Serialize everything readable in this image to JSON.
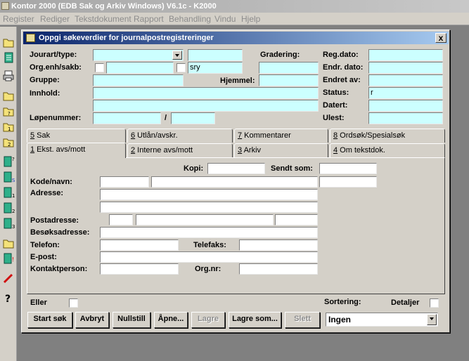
{
  "app": {
    "title": "Kontor 2000 (EDB Sak og Arkiv Windows) V6.1c - K2000"
  },
  "menu": [
    "Register",
    "Rediger",
    "Tekstdokument",
    "Rapport",
    "Behandling",
    "Vindu",
    "Hjelp"
  ],
  "toolbar_icons": [
    "folder-icon",
    "document-icon",
    "printer-icon",
    "folder-icon",
    "folder-icon",
    "folder-icon",
    "folder-icon",
    "document-question-icon",
    "document-s-icon",
    "document-1-icon",
    "document-2-icon",
    "document-3-icon",
    "folder-icon",
    "document-exclaim-icon",
    "pencil-icon",
    "help-icon"
  ],
  "dialog": {
    "title": "Oppgi søkeverdier for journalpostregistreringer",
    "close": "x",
    "labels": {
      "jourart": "Jourart/type:",
      "orgenh": "Org.enh/sakb:",
      "gruppe": "Gruppe:",
      "innhold": "Innhold:",
      "lopenummer": "Løpenummer:",
      "lopenummer_sep": "/",
      "gradering": "Gradering:",
      "hjemmel": "Hjemmel:",
      "regdato": "Reg.dato:",
      "endrdato": "Endr. dato:",
      "endretav": "Endret av:",
      "status": "Status:",
      "datert": "Datert:",
      "ulest": "Ulest:"
    },
    "values": {
      "orgenh_sakb": "sry",
      "status": "r"
    },
    "tabs_back": [
      {
        "num": "5",
        "label": " Sak"
      },
      {
        "num": "6",
        "label": " Utlån/avskr."
      },
      {
        "num": "7",
        "label": " Kommentarer"
      },
      {
        "num": "8",
        "label": " Ordsøk/Spesialsøk"
      }
    ],
    "tabs_front": [
      {
        "num": "1",
        "label": " Ekst. avs/mott"
      },
      {
        "num": "2",
        "label": " Interne avs/mott"
      },
      {
        "num": "3",
        "label": " Arkiv"
      },
      {
        "num": "4",
        "label": " Om tekstdok."
      }
    ],
    "panel": {
      "kopi": "Kopi:",
      "sendt_som": "Sendt som:",
      "kode_navn": "Kode/navn:",
      "adresse": "Adresse:",
      "postadresse": "Postadresse:",
      "besoksadresse": "Besøksadresse:",
      "telefon": "Telefon:",
      "telefaks": "Telefaks:",
      "epost": "E-post:",
      "kontaktperson": "Kontaktperson:",
      "orgnr": "Org.nr:"
    },
    "eller": "Eller",
    "sortering": "Sortering:",
    "detaljer": "Detaljer",
    "sortering_value": "Ingen",
    "buttons": {
      "start": "Start søk",
      "avbryt": "Avbryt",
      "nullstill": "Nullstill",
      "apne": "Åpne...",
      "lagre": "Lagre",
      "lagre_som": "Lagre som...",
      "slett": "Slett"
    }
  }
}
